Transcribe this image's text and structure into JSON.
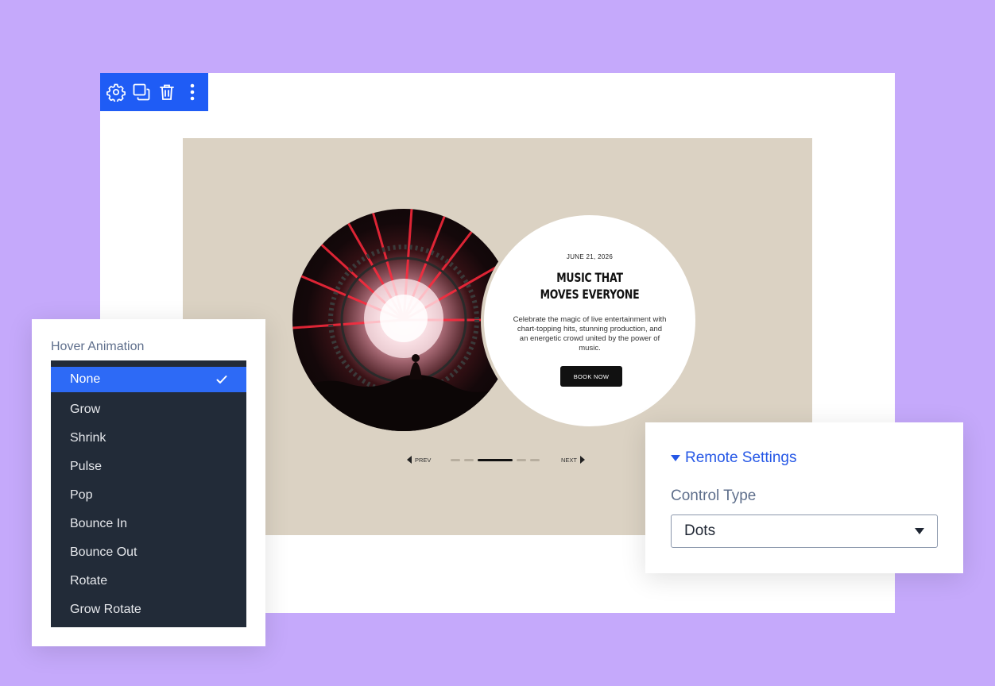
{
  "colors": {
    "background": "#c5a9fb",
    "toolbar": "#1f5cf5",
    "slide": "#dbd2c3",
    "dropdown_bg": "#222b38",
    "dropdown_selected": "#2d6af6",
    "accent_link": "#2557e6"
  },
  "toolbar": {
    "icons": [
      "gear-icon",
      "duplicate-icon",
      "trash-icon",
      "more-vertical-icon"
    ]
  },
  "slide": {
    "date": "JUNE 21, 2026",
    "title_line1": "MUSIC THAT",
    "title_line2": "MOVES EVERYONE",
    "description": "Celebrate the magic of live entertainment with chart-topping hits, stunning production, and an energetic crowd united by the power of music.",
    "cta": "BOOK NOW",
    "prev": "PREV",
    "next": "NEXT",
    "dots_active_index": 2,
    "dots_count": 5
  },
  "hover_panel": {
    "label": "Hover Animation",
    "selected": "None",
    "options": [
      "None",
      "Grow",
      "Shrink",
      "Pulse",
      "Pop",
      "Bounce In",
      "Bounce Out",
      "Rotate",
      "Grow Rotate"
    ]
  },
  "remote_panel": {
    "header": "Remote Settings",
    "control_label": "Control Type",
    "control_value": "Dots"
  }
}
